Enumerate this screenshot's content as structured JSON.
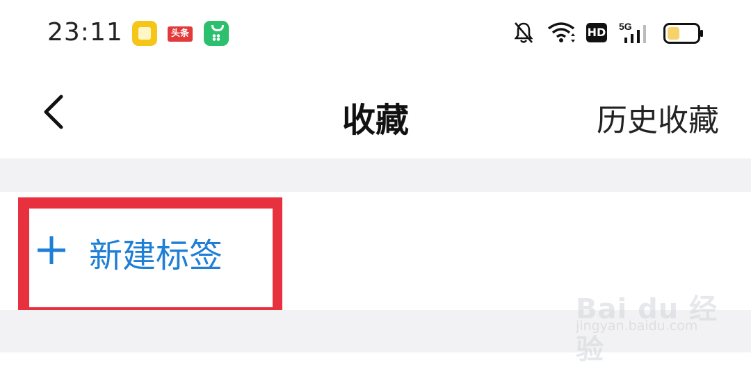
{
  "status_bar": {
    "time": "23:11",
    "toutiao_label": "头条",
    "hd_label": "HD",
    "network_label": "5G",
    "battery_level": 0.4,
    "icons": [
      "notes-app-icon",
      "toutiao-app-icon",
      "shop-app-icon",
      "bell-muted-icon",
      "wifi-icon",
      "hd-icon",
      "signal-5g-icon",
      "battery-icon"
    ]
  },
  "nav": {
    "title": "收藏",
    "history_link": "历史收藏",
    "back_icon": "chevron-left-icon"
  },
  "content": {
    "new_tag_label": "新建标签",
    "plus_icon": "plus-icon"
  },
  "watermark": {
    "brand": "Bai du 经验",
    "url": "jingyan.baidu.com"
  },
  "colors": {
    "accent": "#1f7ed6",
    "highlight": "#e8313f",
    "divider": "#f2f2f4"
  }
}
